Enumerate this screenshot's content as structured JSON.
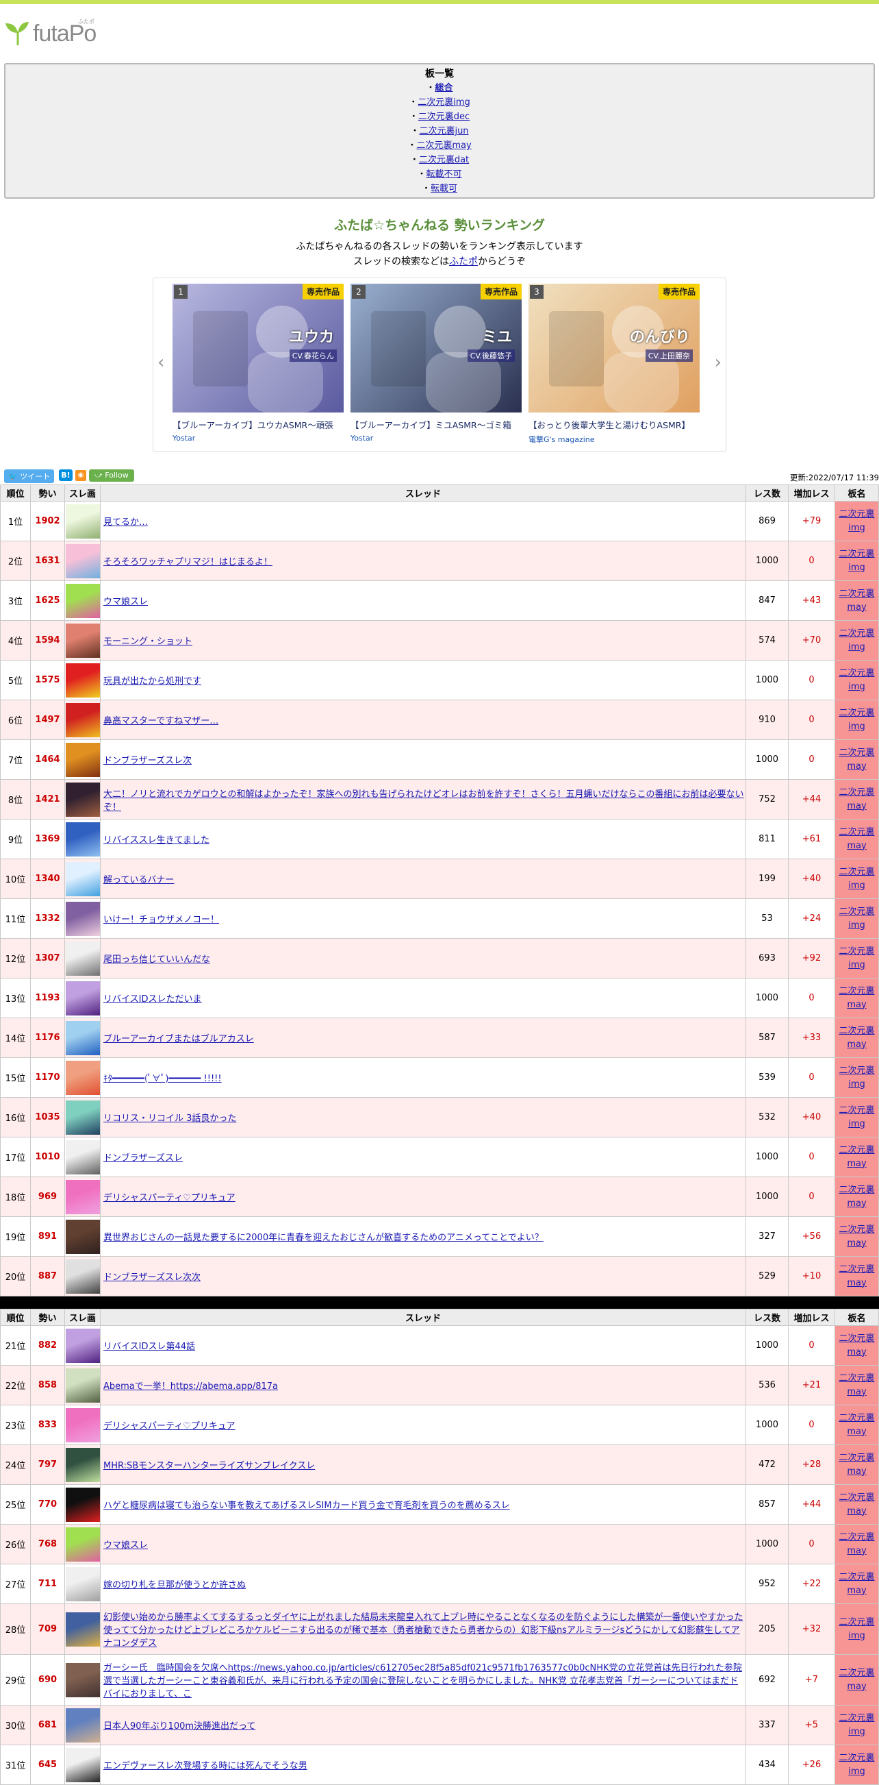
{
  "logo": {
    "text": "futaPo",
    "ruby": "ふたポ"
  },
  "boards": {
    "title": "板一覧",
    "items": [
      {
        "label": "総合",
        "bold": true
      },
      {
        "label": "二次元裏img"
      },
      {
        "label": "二次元裏dec"
      },
      {
        "label": "二次元裏jun"
      },
      {
        "label": "二次元裏may"
      },
      {
        "label": "二次元裏dat"
      },
      {
        "label": "転載不可"
      },
      {
        "label": "転載可"
      }
    ],
    "bullet": "・"
  },
  "ranking": {
    "title": "ふたば☆ちゃんねる 勢いランキング",
    "desc1": "ふたばちゃんねるの各スレッドの勢いをランキング表示しています",
    "desc2_pre": "スレッドの検索などは",
    "desc2_link": "ふたポ",
    "desc2_post": "からどうぞ"
  },
  "carousel": {
    "tag": "専売作品",
    "items": [
      {
        "num": "1",
        "title": "【ブルーアーカイブ】ユウカASMR～頑張",
        "maker": "Yostar",
        "caption": "ユウカ",
        "cv": "CV.春花らん",
        "colors": [
          "#b8b8e0",
          "#5a5aa0"
        ]
      },
      {
        "num": "2",
        "title": "【ブルーアーカイブ】ミユASMR～ゴミ箱",
        "maker": "Yostar",
        "caption": "ミユ",
        "cv": "CV.後藤悠子",
        "colors": [
          "#9ab0d0",
          "#2a3050"
        ]
      },
      {
        "num": "3",
        "title": "【おっとり後輩大学生と湯けむりASMR】",
        "maker": "電撃G's magazine",
        "caption": "のんびり",
        "cv": "CV.上田麗奈",
        "colors": [
          "#f0e0c0",
          "#e0a060"
        ]
      }
    ]
  },
  "social": {
    "tweet": "ツイート",
    "hatena": "B!",
    "rss": "◉",
    "follow": "Follow"
  },
  "updated": "更新:2022/07/17 11:39",
  "table": {
    "headers": [
      "順位",
      "勢い",
      "スレ画",
      "スレッド",
      "レス数",
      "増加レス",
      "板名"
    ]
  },
  "rows1": [
    {
      "rank": "1位",
      "ikioi": "1902",
      "title": "見てるか…",
      "res": "869",
      "inc": "+79",
      "board": "二次元裏img",
      "c": [
        "#eef7e0",
        "#90b070"
      ]
    },
    {
      "rank": "2位",
      "ikioi": "1631",
      "title": "そろそろワッチャプリマジ！はじまるよ！",
      "res": "1000",
      "inc": "0",
      "board": "二次元裏img",
      "c": [
        "#f7c0d8",
        "#70b0e0"
      ]
    },
    {
      "rank": "3位",
      "ikioi": "1625",
      "title": "ウマ娘スレ",
      "res": "847",
      "inc": "+43",
      "board": "二次元裏may",
      "c": [
        "#a0e050",
        "#e060a0"
      ]
    },
    {
      "rank": "4位",
      "ikioi": "1594",
      "title": "モーニング・ショット",
      "res": "574",
      "inc": "+70",
      "board": "二次元裏img",
      "c": [
        "#e08070",
        "#603020"
      ]
    },
    {
      "rank": "5位",
      "ikioi": "1575",
      "title": "玩具が出たから処刑です",
      "res": "1000",
      "inc": "0",
      "board": "二次元裏img",
      "c": [
        "#e02020",
        "#f0d020"
      ]
    },
    {
      "rank": "6位",
      "ikioi": "1497",
      "title": "鼻高マスターですねマザー…",
      "res": "910",
      "inc": "0",
      "board": "二次元裏img",
      "c": [
        "#d02020",
        "#f0c020"
      ]
    },
    {
      "rank": "7位",
      "ikioi": "1464",
      "title": "ドンブラザーズスレ次",
      "res": "1000",
      "inc": "0",
      "board": "二次元裏may",
      "c": [
        "#e09020",
        "#803010"
      ]
    },
    {
      "rank": "8位",
      "ikioi": "1421",
      "title": "大二！ノリと流れでカゲロウとの和解はよかったぞ！家族への別れも告げられたけどオレはお前を許すぞ！さくら！五月蝿いだけならこの番組にお前は必要ないぞ！",
      "res": "752",
      "inc": "+44",
      "board": "二次元裏may",
      "c": [
        "#302030",
        "#a06040"
      ]
    },
    {
      "rank": "9位",
      "ikioi": "1369",
      "title": "リバイススレ生きてました",
      "res": "811",
      "inc": "+61",
      "board": "二次元裏may",
      "c": [
        "#3060c0",
        "#90c0f0"
      ]
    },
    {
      "rank": "10位",
      "ikioi": "1340",
      "title": "解っているバナー",
      "res": "199",
      "inc": "+40",
      "board": "二次元裏img",
      "c": [
        "#e0f0ff",
        "#40a0e0"
      ]
    },
    {
      "rank": "11位",
      "ikioi": "1332",
      "title": "いけー！チョウザメノコー！",
      "res": "53",
      "inc": "+24",
      "board": "二次元裏img",
      "c": [
        "#8060a0",
        "#f0d0e0"
      ]
    },
    {
      "rank": "12位",
      "ikioi": "1307",
      "title": "尾田っち信じていいんだな",
      "res": "693",
      "inc": "+92",
      "board": "二次元裏img",
      "c": [
        "#f0f0f0",
        "#707070"
      ]
    },
    {
      "rank": "13位",
      "ikioi": "1193",
      "title": "リバイスIDスレただいま",
      "res": "1000",
      "inc": "0",
      "board": "二次元裏may",
      "c": [
        "#c0a0e0",
        "#502080"
      ]
    },
    {
      "rank": "14位",
      "ikioi": "1176",
      "title": "ブルーアーカイブまたはブルアカスレ",
      "res": "587",
      "inc": "+33",
      "board": "二次元裏may",
      "c": [
        "#a0d0f0",
        "#2060c0"
      ]
    },
    {
      "rank": "15位",
      "ikioi": "1170",
      "title": "ｷﾀ━━━━━━(ﾟ∀ﾟ)━━━━━━ !!!!!",
      "res": "539",
      "inc": "0",
      "board": "二次元裏img",
      "c": [
        "#f0a080",
        "#e05030"
      ]
    },
    {
      "rank": "16位",
      "ikioi": "1035",
      "title": "リコリス・リコイル 3話良かった",
      "res": "532",
      "inc": "+40",
      "board": "二次元裏img",
      "c": [
        "#80d0c0",
        "#204060"
      ]
    },
    {
      "rank": "17位",
      "ikioi": "1010",
      "title": "ドンブラザーズスレ",
      "res": "1000",
      "inc": "0",
      "board": "二次元裏may",
      "c": [
        "#f0f0f0",
        "#606060"
      ]
    },
    {
      "rank": "18位",
      "ikioi": "969",
      "title": "デリシャスパーティ♡プリキュア",
      "res": "1000",
      "inc": "0",
      "board": "二次元裏may",
      "c": [
        "#f070c0",
        "#f0a0e0"
      ]
    },
    {
      "rank": "19位",
      "ikioi": "891",
      "title": "異世界おじさんの一話見た要するに2000年に青春を迎えたおじさんが歓喜するためのアニメってことでよい？",
      "res": "327",
      "inc": "+56",
      "board": "二次元裏may",
      "c": [
        "#604030",
        "#302020"
      ]
    },
    {
      "rank": "20位",
      "ikioi": "887",
      "title": "ドンブラザーズスレ次次",
      "res": "529",
      "inc": "+10",
      "board": "二次元裏may",
      "c": [
        "#e0e0e0",
        "#404040"
      ]
    }
  ],
  "rows2": [
    {
      "rank": "21位",
      "ikioi": "882",
      "title": "リバイスIDスレ第44話",
      "res": "1000",
      "inc": "0",
      "board": "二次元裏may",
      "c": [
        "#c0a0e0",
        "#502080"
      ]
    },
    {
      "rank": "22位",
      "ikioi": "858",
      "title": "Abemaで一挙！https://abema.app/817a",
      "res": "536",
      "inc": "+21",
      "board": "二次元裏may",
      "c": [
        "#d0e0c0",
        "#506040"
      ]
    },
    {
      "rank": "23位",
      "ikioi": "833",
      "title": "デリシャスパーティ♡プリキュア",
      "res": "1000",
      "inc": "0",
      "board": "二次元裏may",
      "c": [
        "#f070c0",
        "#f0a0e0"
      ]
    },
    {
      "rank": "24位",
      "ikioi": "797",
      "title": "MHR:SBモンスターハンターライズサンブレイクスレ",
      "res": "472",
      "inc": "+28",
      "board": "二次元裏may",
      "c": [
        "#305040",
        "#c0e0a0"
      ]
    },
    {
      "rank": "25位",
      "ikioi": "770",
      "title": "ハゲと糖尿病は寝ても治らない事を教えてあげるスレSIMカード買う金で育毛剤を買うのを薦めるスレ",
      "res": "857",
      "inc": "+44",
      "board": "二次元裏may",
      "c": [
        "#101010",
        "#e02020"
      ]
    },
    {
      "rank": "26位",
      "ikioi": "768",
      "title": "ウマ娘スレ",
      "res": "1000",
      "inc": "0",
      "board": "二次元裏may",
      "c": [
        "#a0e050",
        "#e060a0"
      ]
    },
    {
      "rank": "27位",
      "ikioi": "711",
      "title": "嫁の切り札を旦那が使うとか許さぬ",
      "res": "952",
      "inc": "+22",
      "board": "二次元裏may",
      "c": [
        "#f0f0f0",
        "#a0a0a0"
      ]
    },
    {
      "rank": "28位",
      "ikioi": "709",
      "title": "幻影使い始めから勝率よくてするするっとダイヤに上がれました結局未来龍皇入れて上プレ時にやることなくなるのを防ぐようにした構築が一番使いやすかった使ってて分かったけど上ブレどころかケルビーニすら出るのが稀で基本（勇者槍動できたら勇者からの）幻影下級nsアルミラージsどうにかして幻影蘇生してアナコンダデス",
      "res": "205",
      "inc": "+32",
      "board": "二次元裏img",
      "c": [
        "#4060a0",
        "#e0b040"
      ]
    },
    {
      "rank": "29位",
      "ikioi": "690",
      "title": "ガーシー氏　臨時国会を欠席へhttps://news.yahoo.co.jp/articles/c612705ec28f5a85df021c9571fb1763577c0b0cNHK党の立花党首は先日行われた参院選で当選したガーシーこと東谷義和氏が、来月に行われる予定の国会に登院しないことを明らかにしました。NHK党 立花孝志党首「ガーシーについてはまだドバイにおりまして、こ",
      "res": "692",
      "inc": "+7",
      "board": "二次元裏may",
      "c": [
        "#806050",
        "#403030"
      ]
    },
    {
      "rank": "30位",
      "ikioi": "681",
      "title": "日本人90年ぶり100m決勝進出だって",
      "res": "337",
      "inc": "+5",
      "board": "二次元裏img",
      "c": [
        "#6080c0",
        "#d0b090"
      ]
    },
    {
      "rank": "31位",
      "ikioi": "645",
      "title": "エンデヴァースレ次登場する時には死んでそうな男",
      "res": "434",
      "inc": "+26",
      "board": "二次元裏img",
      "c": [
        "#f0f0f0",
        "#202020"
      ]
    }
  ]
}
